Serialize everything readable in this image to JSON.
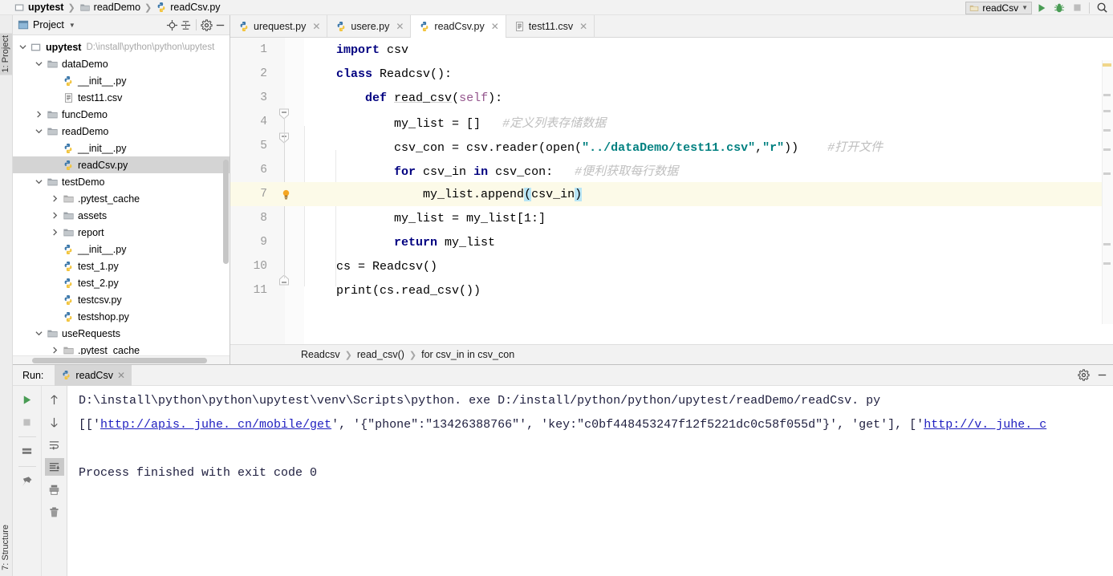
{
  "titlebar": {
    "breadcrumbs": [
      {
        "label": "upytest",
        "icon": "module-icon",
        "bold": true
      },
      {
        "label": "readDemo",
        "icon": "folder-icon",
        "bold": false
      },
      {
        "label": "readCsv.py",
        "icon": "python-file-icon",
        "bold": false
      }
    ],
    "run_config": "readCsv",
    "icons": [
      "run-icon",
      "debug-icon",
      "stop-icon",
      "search-icon"
    ]
  },
  "left_strips": {
    "project_label": "1: Project",
    "structure_label": "7: Structure"
  },
  "project_panel": {
    "title": "Project",
    "header_icons": [
      "target-icon",
      "collapse-all-icon",
      "gear-icon",
      "hide-icon"
    ],
    "tree": [
      {
        "depth": 0,
        "arrow": "down",
        "icon": "module-icon",
        "label": "upytest",
        "bold": true,
        "path": "D:\\install\\python\\python\\upytest",
        "selected": false
      },
      {
        "depth": 1,
        "arrow": "down",
        "icon": "folder-icon",
        "label": "dataDemo",
        "bold": false,
        "path": "",
        "selected": false
      },
      {
        "depth": 2,
        "arrow": "none",
        "icon": "python-file-icon",
        "label": "__init__.py",
        "bold": false,
        "path": "",
        "selected": false
      },
      {
        "depth": 2,
        "arrow": "none",
        "icon": "csv-file-icon",
        "label": "test11.csv",
        "bold": false,
        "path": "",
        "selected": false
      },
      {
        "depth": 1,
        "arrow": "right",
        "icon": "folder-icon",
        "label": "funcDemo",
        "bold": false,
        "path": "",
        "selected": false
      },
      {
        "depth": 1,
        "arrow": "down",
        "icon": "folder-icon",
        "label": "readDemo",
        "bold": false,
        "path": "",
        "selected": false
      },
      {
        "depth": 2,
        "arrow": "none",
        "icon": "python-file-icon",
        "label": "__init__.py",
        "bold": false,
        "path": "",
        "selected": false
      },
      {
        "depth": 2,
        "arrow": "none",
        "icon": "python-file-icon",
        "label": "readCsv.py",
        "bold": false,
        "path": "",
        "selected": true
      },
      {
        "depth": 1,
        "arrow": "down",
        "icon": "folder-icon",
        "label": "testDemo",
        "bold": false,
        "path": "",
        "selected": false
      },
      {
        "depth": 2,
        "arrow": "right",
        "icon": "folder-plain-icon",
        "label": ".pytest_cache",
        "bold": false,
        "path": "",
        "selected": false
      },
      {
        "depth": 2,
        "arrow": "right",
        "icon": "folder-icon",
        "label": "assets",
        "bold": false,
        "path": "",
        "selected": false
      },
      {
        "depth": 2,
        "arrow": "right",
        "icon": "folder-icon",
        "label": "report",
        "bold": false,
        "path": "",
        "selected": false
      },
      {
        "depth": 2,
        "arrow": "none",
        "icon": "python-file-icon",
        "label": "__init__.py",
        "bold": false,
        "path": "",
        "selected": false
      },
      {
        "depth": 2,
        "arrow": "none",
        "icon": "python-file-icon",
        "label": "test_1.py",
        "bold": false,
        "path": "",
        "selected": false
      },
      {
        "depth": 2,
        "arrow": "none",
        "icon": "python-file-icon",
        "label": "test_2.py",
        "bold": false,
        "path": "",
        "selected": false
      },
      {
        "depth": 2,
        "arrow": "none",
        "icon": "python-file-icon",
        "label": "testcsv.py",
        "bold": false,
        "path": "",
        "selected": false
      },
      {
        "depth": 2,
        "arrow": "none",
        "icon": "python-file-icon",
        "label": "testshop.py",
        "bold": false,
        "path": "",
        "selected": false
      },
      {
        "depth": 1,
        "arrow": "down",
        "icon": "folder-icon",
        "label": "useRequests",
        "bold": false,
        "path": "",
        "selected": false
      },
      {
        "depth": 2,
        "arrow": "right",
        "icon": "folder-plain-icon",
        "label": ".pytest_cache",
        "bold": false,
        "path": "",
        "selected": false
      }
    ]
  },
  "editor": {
    "tabs": [
      {
        "label": "urequest.py",
        "icon": "python-file-icon",
        "active": false
      },
      {
        "label": "usere.py",
        "icon": "python-file-icon",
        "active": false
      },
      {
        "label": "readCsv.py",
        "icon": "python-file-icon",
        "active": true
      },
      {
        "label": "test11.csv",
        "icon": "csv-file-icon",
        "active": false
      }
    ],
    "lines": [
      {
        "n": "1",
        "text": "import csv"
      },
      {
        "n": "2",
        "text": "class Readcsv():"
      },
      {
        "n": "3",
        "text": "    def read_csv(self):"
      },
      {
        "n": "4",
        "text": "        my_list = []     #定义列表存储数据"
      },
      {
        "n": "5",
        "text": "        csv_con = csv.reader(open(\"../dataDemo/test11.csv\",\"r\"))    #打开文件"
      },
      {
        "n": "6",
        "text": "        for csv_in in csv_con:    #便利获取每行数据"
      },
      {
        "n": "7",
        "text": "            my_list.append(csv_in)"
      },
      {
        "n": "8",
        "text": "        my_list = my_list[1:]"
      },
      {
        "n": "9",
        "text": "        return my_list"
      },
      {
        "n": "10",
        "text": "cs = Readcsv()"
      },
      {
        "n": "11",
        "text": "print(cs.read_csv())"
      }
    ],
    "breadcrumb": [
      "Readcsv",
      "read_csv()",
      "for csv_in in csv_con"
    ]
  },
  "run_panel": {
    "label": "Run:",
    "tab_label": "readCsv",
    "tab_icon": "python-file-icon",
    "header_icons": [
      "gear-icon",
      "hide-icon"
    ],
    "toolbar_left": [
      "run-icon",
      "stop-icon",
      "rerun-icon",
      "pin-icon"
    ],
    "toolbar_right": [
      "up-arrow-icon",
      "down-arrow-icon",
      "soft-wrap-icon",
      "scroll-to-end-icon",
      "print-icon",
      "trash-icon"
    ],
    "console": {
      "line1_cmd": "D:\\install\\python\\python\\upytest\\venv\\Scripts\\python. exe D:/install/python/python/upytest/readDemo/readCsv. py",
      "line2_prefix": "[['",
      "line2_link1": "http://apis. juhe. cn/mobile/get",
      "line2_mid": "', '{\"phone\":\"13426388766\"', 'key:\"c0bf448453247f12f5221dc0c58f055d\"}', 'get'], ['",
      "line2_link2": "http://v. juhe. c",
      "line4": "Process finished with exit code 0"
    }
  }
}
